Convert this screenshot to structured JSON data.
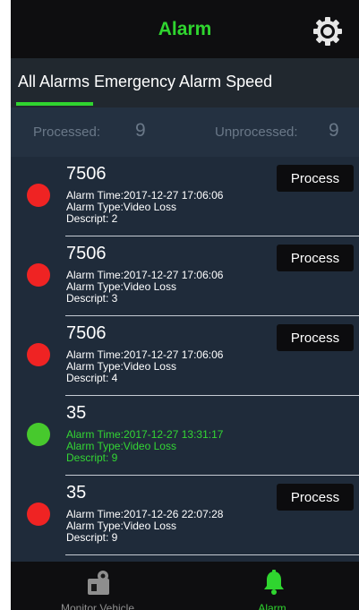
{
  "header": {
    "title": "Alarm",
    "settings_icon": "gear-icon"
  },
  "tabs": {
    "label": "All Alarms Emergency Alarm Speed",
    "active_index": 0
  },
  "counters": {
    "processed_label": "Processed:",
    "processed_value": "9",
    "unprocessed_label": "Unprocessed:",
    "unprocessed_value": "9"
  },
  "alarms": [
    {
      "title": "7506",
      "time": "Alarm Time:2017-12-27 17:06:06",
      "type": "Alarm Type:Video Loss",
      "descript": "Descript: 2",
      "status": "red",
      "button": "Process"
    },
    {
      "title": "7506",
      "time": "Alarm Time:2017-12-27 17:06:06",
      "type": "Alarm Type:Video Loss",
      "descript": "Descript: 3",
      "status": "red",
      "button": "Process"
    },
    {
      "title": "7506",
      "time": "Alarm Time:2017-12-27 17:06:06",
      "type": "Alarm Type:Video Loss",
      "descript": "Descript: 4",
      "status": "red",
      "button": "Process"
    },
    {
      "title": "35",
      "time": "Alarm Time:2017-12-27 13:31:17",
      "type": "Alarm Type:Video Loss",
      "descript": "Descript: 9",
      "status": "green",
      "button": ""
    },
    {
      "title": "35",
      "time": "Alarm Time:2017-12-26 22:07:28",
      "type": "Alarm Type:Video Loss",
      "descript": "Descript: 9",
      "status": "red",
      "button": "Process"
    }
  ],
  "bottom_nav": {
    "left": {
      "label": "Monitor Vehicle",
      "icon": "monitor-vehicle-icon"
    },
    "right": {
      "label": "Alarm",
      "icon": "bell-icon"
    }
  },
  "colors": {
    "accent": "#2fd52f",
    "alarm_red": "#ef2323",
    "alarm_green": "#47c92d",
    "background": "#1f2b3a"
  }
}
